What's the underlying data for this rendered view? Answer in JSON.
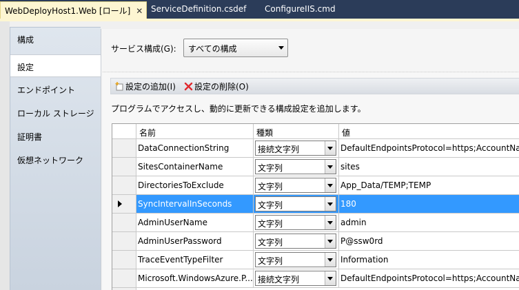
{
  "tabs": [
    {
      "label": "WebDeployHost1.Web [ロール]",
      "active": true
    },
    {
      "label": "ServiceDefinition.csdef",
      "active": false
    },
    {
      "label": "ConfigureIIS.cmd",
      "active": false
    }
  ],
  "nav": {
    "items": [
      {
        "label": "構成"
      },
      {
        "label": "設定",
        "active": true
      },
      {
        "label": "エンドポイント"
      },
      {
        "label": "ローカル ストレージ"
      },
      {
        "label": "証明書"
      },
      {
        "label": "仮想ネットワーク"
      }
    ]
  },
  "service_config": {
    "label": "サービス構成(G):",
    "selected": "すべての構成"
  },
  "toolbar": {
    "add_label": "設定の追加(I)",
    "delete_label": "設定の削除(O)"
  },
  "description": "プログラムでアクセスし、動的に更新できる構成設定を追加します。",
  "grid": {
    "headers": {
      "name": "名前",
      "type": "種類",
      "value": "値"
    },
    "rows": [
      {
        "name": "DataConnectionString",
        "type": "接続文字列",
        "value": "DefaultEndpointsProtocol=https;AccountNa"
      },
      {
        "name": "SitesContainerName",
        "type": "文字列",
        "value": "sites"
      },
      {
        "name": "DirectoriesToExclude",
        "type": "文字列",
        "value": "App_Data/TEMP;TEMP"
      },
      {
        "name": "SyncIntervalInSeconds",
        "type": "文字列",
        "value": "180",
        "selected": true
      },
      {
        "name": "AdminUserName",
        "type": "文字列",
        "value": "admin"
      },
      {
        "name": "AdminUserPassword",
        "type": "文字列",
        "value": "P@ssw0rd"
      },
      {
        "name": "TraceEventTypeFilter",
        "type": "文字列",
        "value": "Information"
      },
      {
        "name": "Microsoft.WindowsAzure.P...",
        "type": "接続文字列",
        "value": "DefaultEndpointsProtocol=https;AccountNam"
      }
    ]
  },
  "colors": {
    "tab_strip": "#2b3c59",
    "active_tab": "#fdf6d2",
    "selection": "#3399ff",
    "delete_icon": "#e0282d"
  }
}
